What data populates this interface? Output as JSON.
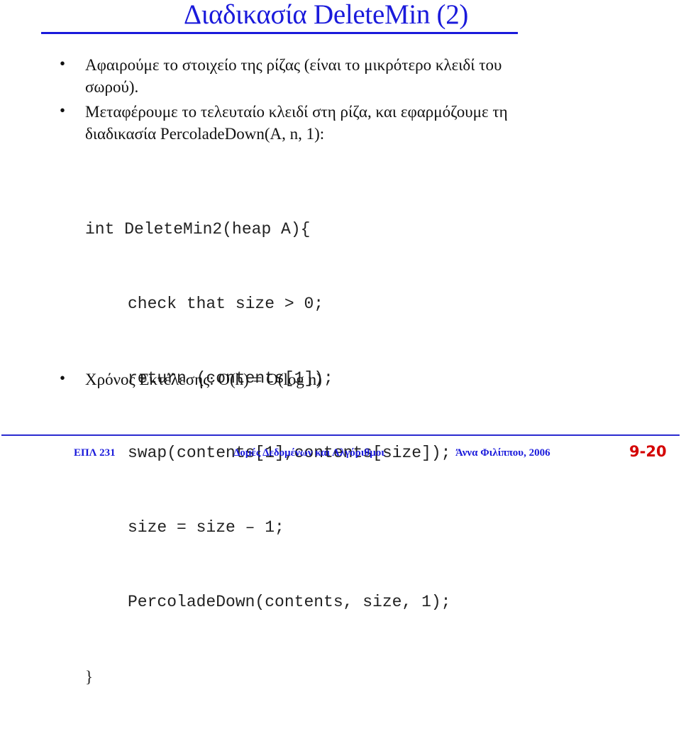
{
  "slide": {
    "title": "Διαδικασία DeleteMin (2)",
    "bullets": [
      {
        "glyph": "•",
        "lines": [
          "Αφαιρούμε το στοιχείο της ρίζας (είναι το μικρότερο κλειδί του",
          "σωρού)."
        ]
      },
      {
        "glyph": "•",
        "lines": [
          "Μεταφέρουμε το τελευταίο κλειδί στη ρίζα,  και εφαρμόζουμε τη",
          "διαδικασία PercoladeDown(A, n, 1):"
        ]
      },
      {
        "glyph": "•",
        "lines": [
          "Χρόνος Εκτέλεσης: O(h) = O(log n)"
        ]
      }
    ],
    "code": [
      "int DeleteMin2(heap A){",
      "check that size > 0;",
      "return (contents[1]);",
      "swap(contents[1],contents[size]);",
      "size = size – 1;",
      "PercoladeDown(contents, size, 1);",
      "}"
    ]
  },
  "footer": {
    "course": "ΕΠΛ 231",
    "subject": "Δομές Δεδομένων και Αλγόριθμοι",
    "author": "Άννα Φιλίππου, 2006",
    "page": "9-20"
  },
  "colors": {
    "title": "#1a1adb",
    "rule": "#1a1adb",
    "page_number": "#d40000"
  }
}
